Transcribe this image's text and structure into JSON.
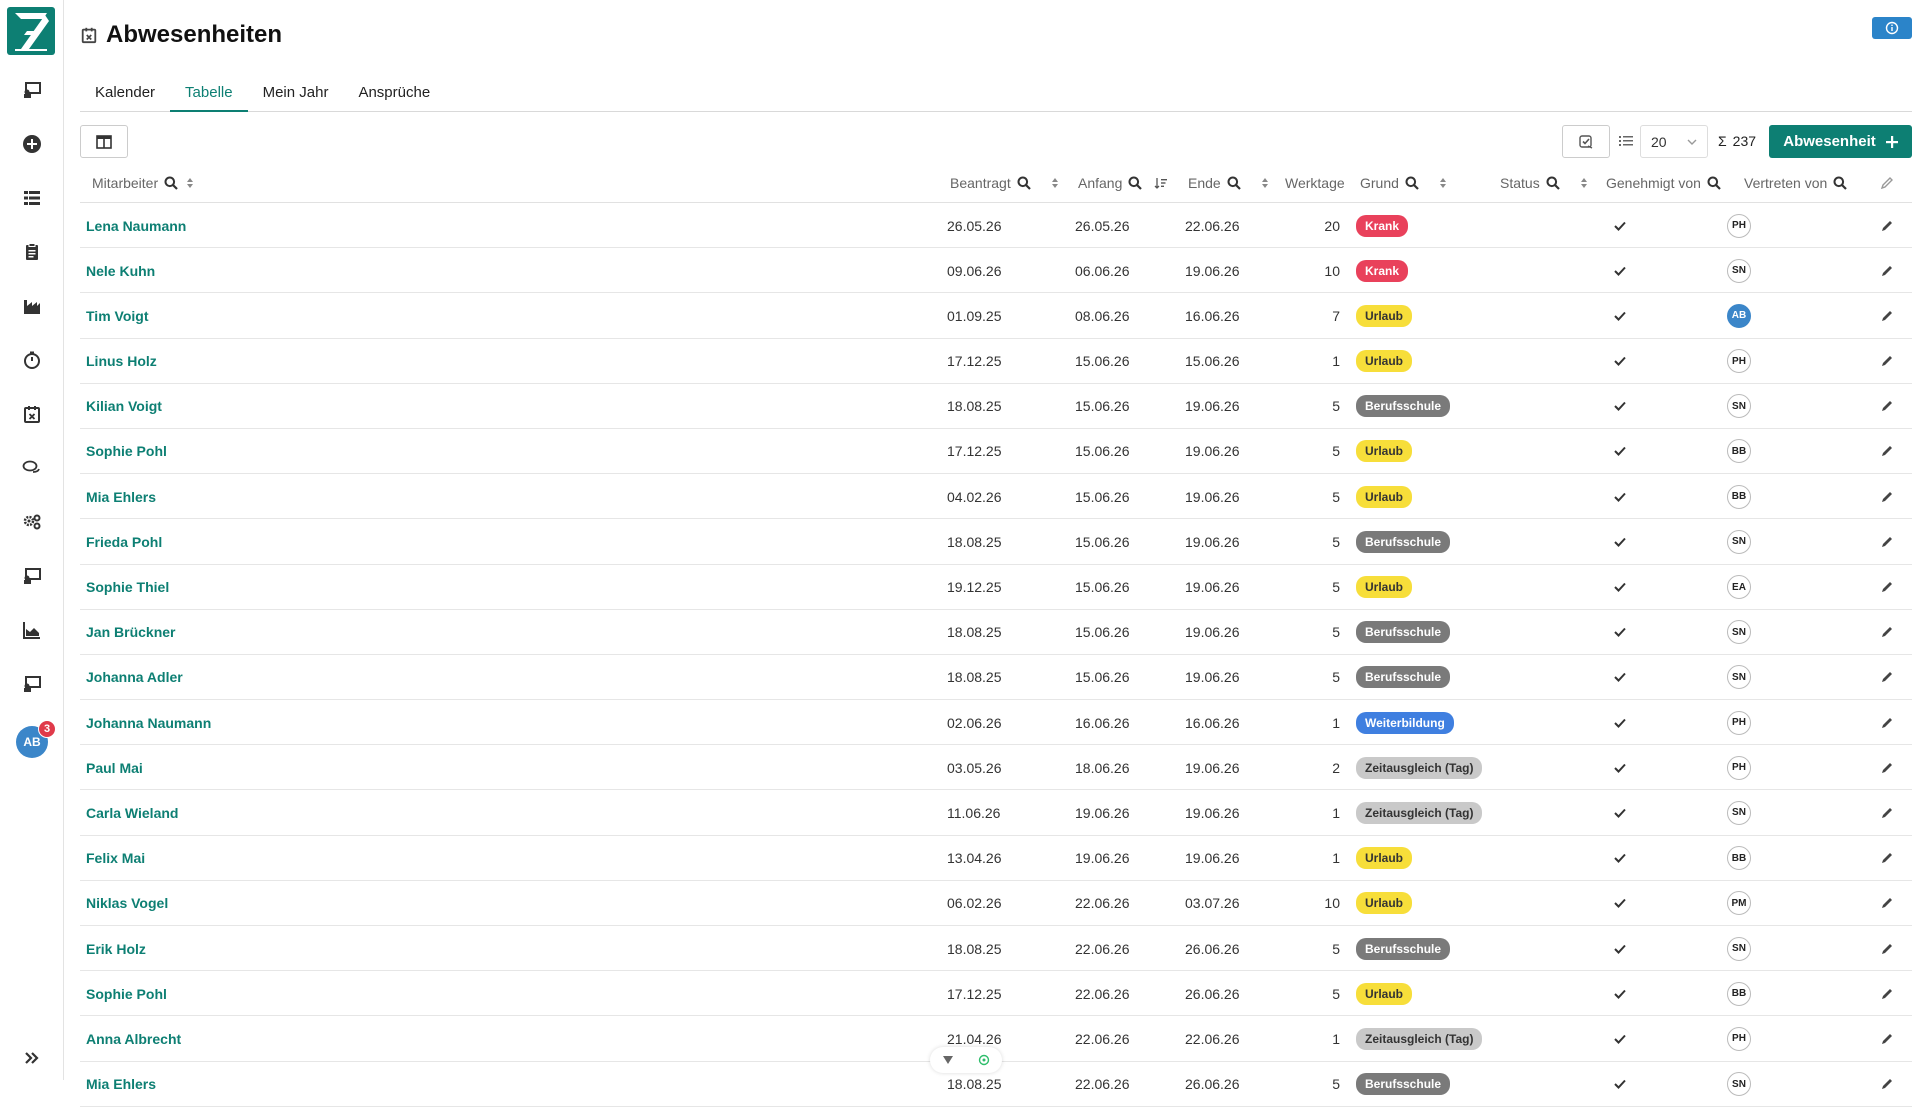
{
  "page": {
    "title": "Abwesenheiten"
  },
  "tabs": [
    {
      "label": "Kalender",
      "active": false
    },
    {
      "label": "Tabelle",
      "active": true
    },
    {
      "label": "Mein Jahr",
      "active": false
    },
    {
      "label": "Ansprüche",
      "active": false
    }
  ],
  "toolbar": {
    "page_size": "20",
    "sum_symbol": "Σ",
    "total": "237",
    "add_label": "Abwesenheit"
  },
  "sidebar": {
    "user_initials": "AB",
    "notification_count": "3"
  },
  "columns": {
    "mitarbeiter": "Mitarbeiter",
    "beantragt": "Beantragt",
    "anfang": "Anfang",
    "ende": "Ende",
    "werktage": "Werktage",
    "grund": "Grund",
    "status": "Status",
    "genehmigt": "Genehmigt von",
    "vertreten": "Vertreten von"
  },
  "colors": {
    "accent": "#0d7f73",
    "krank": "#e9415b",
    "urlaub": "#f7de3a",
    "berufsschule": "#7a7a7a",
    "weiterbildung": "#3f7fe0",
    "zeitausgleich": "#c9c9c9"
  },
  "rows": [
    {
      "name": "Lena Naumann",
      "beantragt": "26.05.26",
      "anfang": "26.05.26",
      "ende": "22.06.26",
      "werktage": "20",
      "grund": "Krank",
      "kind": "krank",
      "genehmigt": "PH"
    },
    {
      "name": "Nele Kuhn",
      "beantragt": "09.06.26",
      "anfang": "06.06.26",
      "ende": "19.06.26",
      "werktage": "10",
      "grund": "Krank",
      "kind": "krank",
      "genehmigt": "SN"
    },
    {
      "name": "Tim Voigt",
      "beantragt": "01.09.25",
      "anfang": "08.06.26",
      "ende": "16.06.26",
      "werktage": "7",
      "grund": "Urlaub",
      "kind": "urlaub",
      "genehmigt": "AB",
      "highlight": true
    },
    {
      "name": "Linus Holz",
      "beantragt": "17.12.25",
      "anfang": "15.06.26",
      "ende": "15.06.26",
      "werktage": "1",
      "grund": "Urlaub",
      "kind": "urlaub",
      "genehmigt": "PH"
    },
    {
      "name": "Kilian Voigt",
      "beantragt": "18.08.25",
      "anfang": "15.06.26",
      "ende": "19.06.26",
      "werktage": "5",
      "grund": "Berufsschule",
      "kind": "berufs",
      "genehmigt": "SN"
    },
    {
      "name": "Sophie Pohl",
      "beantragt": "17.12.25",
      "anfang": "15.06.26",
      "ende": "19.06.26",
      "werktage": "5",
      "grund": "Urlaub",
      "kind": "urlaub",
      "genehmigt": "BB"
    },
    {
      "name": "Mia Ehlers",
      "beantragt": "04.02.26",
      "anfang": "15.06.26",
      "ende": "19.06.26",
      "werktage": "5",
      "grund": "Urlaub",
      "kind": "urlaub",
      "genehmigt": "BB"
    },
    {
      "name": "Frieda Pohl",
      "beantragt": "18.08.25",
      "anfang": "15.06.26",
      "ende": "19.06.26",
      "werktage": "5",
      "grund": "Berufsschule",
      "kind": "berufs",
      "genehmigt": "SN"
    },
    {
      "name": "Sophie Thiel",
      "beantragt": "19.12.25",
      "anfang": "15.06.26",
      "ende": "19.06.26",
      "werktage": "5",
      "grund": "Urlaub",
      "kind": "urlaub",
      "genehmigt": "EA"
    },
    {
      "name": "Jan Brückner",
      "beantragt": "18.08.25",
      "anfang": "15.06.26",
      "ende": "19.06.26",
      "werktage": "5",
      "grund": "Berufsschule",
      "kind": "berufs",
      "genehmigt": "SN"
    },
    {
      "name": "Johanna Adler",
      "beantragt": "18.08.25",
      "anfang": "15.06.26",
      "ende": "19.06.26",
      "werktage": "5",
      "grund": "Berufsschule",
      "kind": "berufs",
      "genehmigt": "SN"
    },
    {
      "name": "Johanna Naumann",
      "beantragt": "02.06.26",
      "anfang": "16.06.26",
      "ende": "16.06.26",
      "werktage": "1",
      "grund": "Weiterbildung",
      "kind": "weiter",
      "genehmigt": "PH"
    },
    {
      "name": "Paul Mai",
      "beantragt": "03.05.26",
      "anfang": "18.06.26",
      "ende": "19.06.26",
      "werktage": "2",
      "grund": "Zeitausgleich (Tag)",
      "kind": "zeit",
      "genehmigt": "PH"
    },
    {
      "name": "Carla Wieland",
      "beantragt": "11.06.26",
      "anfang": "19.06.26",
      "ende": "19.06.26",
      "werktage": "1",
      "grund": "Zeitausgleich (Tag)",
      "kind": "zeit",
      "genehmigt": "SN"
    },
    {
      "name": "Felix Mai",
      "beantragt": "13.04.26",
      "anfang": "19.06.26",
      "ende": "19.06.26",
      "werktage": "1",
      "grund": "Urlaub",
      "kind": "urlaub",
      "genehmigt": "BB"
    },
    {
      "name": "Niklas Vogel",
      "beantragt": "06.02.26",
      "anfang": "22.06.26",
      "ende": "03.07.26",
      "werktage": "10",
      "grund": "Urlaub",
      "kind": "urlaub",
      "genehmigt": "PM"
    },
    {
      "name": "Erik Holz",
      "beantragt": "18.08.25",
      "anfang": "22.06.26",
      "ende": "26.06.26",
      "werktage": "5",
      "grund": "Berufsschule",
      "kind": "berufs",
      "genehmigt": "SN"
    },
    {
      "name": "Sophie Pohl",
      "beantragt": "17.12.25",
      "anfang": "22.06.26",
      "ende": "26.06.26",
      "werktage": "5",
      "grund": "Urlaub",
      "kind": "urlaub",
      "genehmigt": "BB"
    },
    {
      "name": "Anna Albrecht",
      "beantragt": "21.04.26",
      "anfang": "22.06.26",
      "ende": "22.06.26",
      "werktage": "1",
      "grund": "Zeitausgleich (Tag)",
      "kind": "zeit",
      "genehmigt": "PH"
    },
    {
      "name": "Mia Ehlers",
      "beantragt": "18.08.25",
      "anfang": "22.06.26",
      "ende": "26.06.26",
      "werktage": "5",
      "grund": "Berufsschule",
      "kind": "berufs",
      "genehmigt": "SN"
    }
  ]
}
